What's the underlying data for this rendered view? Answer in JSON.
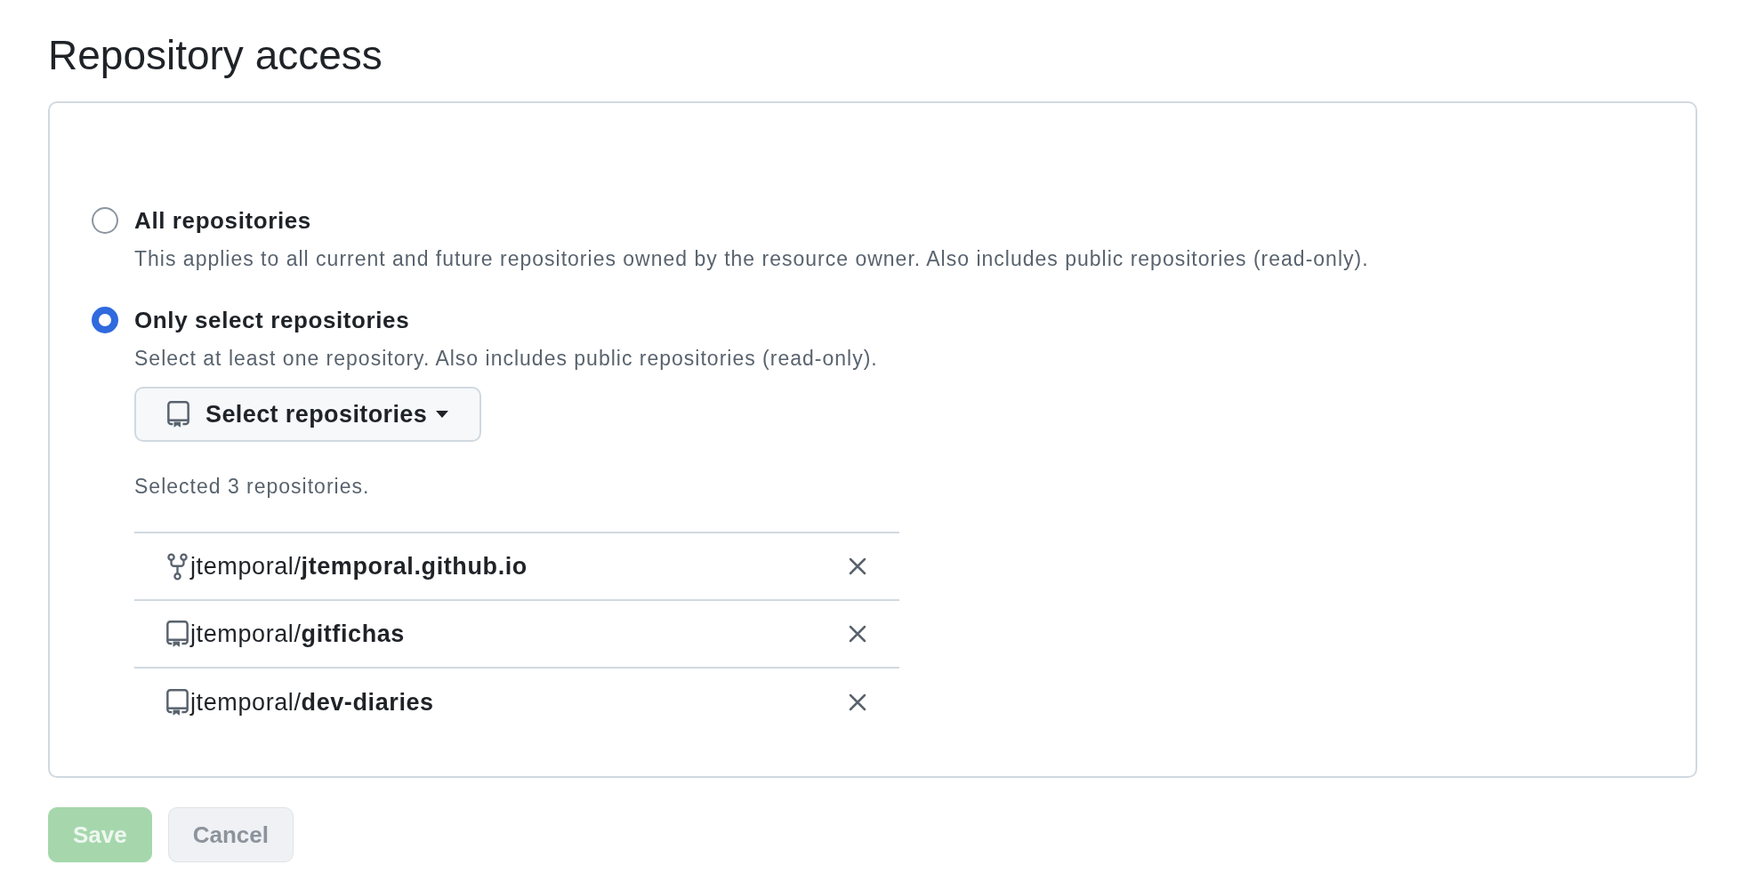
{
  "title": "Repository access",
  "options": [
    {
      "label": "All repositories",
      "description": "This applies to all current and future repositories owned by the resource owner. Also includes public repositories (read-only).",
      "selected": false
    },
    {
      "label": "Only select repositories",
      "description": "Select at least one repository. Also includes public repositories (read-only).",
      "selected": true
    }
  ],
  "repository_picker": {
    "label": "Select repositories",
    "selected_count": "Selected 3 repositories."
  },
  "repositories": [
    {
      "kind": "fork",
      "name": "jtemporal/**jtemporal.github.io**"
    },
    {
      "kind": "repo",
      "name": "jtemporal/**gitfichas**"
    },
    {
      "kind": "repo",
      "name": "jtemporal/**dev-diaries**"
    }
  ],
  "buttons": [
    {
      "label": "Save",
      "kind": "primary",
      "disabled": true
    },
    {
      "label": "Cancel",
      "kind": "secondary",
      "disabled": true
    }
  ]
}
